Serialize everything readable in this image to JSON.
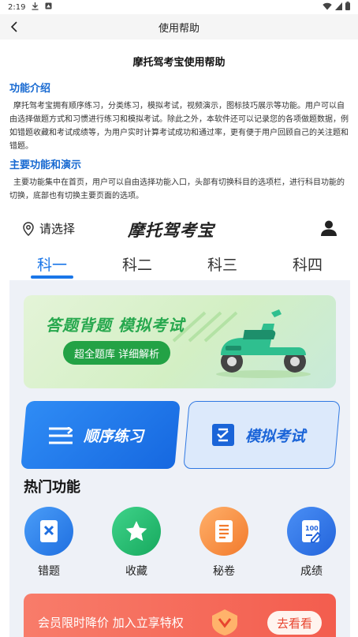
{
  "status_bar": {
    "time": "2:19"
  },
  "nav": {
    "title": "使用帮助"
  },
  "doc": {
    "title": "摩托驾考宝使用帮助",
    "sections": [
      {
        "heading": "功能介绍",
        "body": "摩托驾考宝拥有顺序练习，分类练习，模拟考试，视频演示，图标技巧展示等功能。用户可以自由选择做题方式和习惯进行练习和模拟考试。除此之外，本软件还可以记录您的各项做题数据，例如错题收藏和考试成绩等，为用户实时计算考试成功和通过率，更有便于用户回顾自己的关注题和错题。"
      },
      {
        "heading": "主要功能和演示",
        "body": "主要功能集中在首页，用户可以自由选择功能入口，头部有切换科目的选项栏，进行科目功能的切换，底部也有切换主要页面的选项。"
      }
    ]
  },
  "app": {
    "location_label": "请选择",
    "logo_text": "摩托驾考宝",
    "tabs": [
      "科一",
      "科二",
      "科三",
      "科四"
    ],
    "active_tab": 0,
    "banner": {
      "slogan": "答题背题  模拟考试",
      "pill": "超全题库 详细解析"
    },
    "cards": {
      "sequential": "顺序练习",
      "mock": "模拟考试"
    },
    "hot_title": "热门功能",
    "features": [
      {
        "label": "错题",
        "icon": "wrong-questions-icon"
      },
      {
        "label": "收藏",
        "icon": "star-icon"
      },
      {
        "label": "秘卷",
        "icon": "secret-paper-icon"
      },
      {
        "label": "成绩",
        "icon": "score-icon"
      }
    ],
    "vip": {
      "text": "会员限时降价 加入立享特权",
      "button": "去看看"
    }
  },
  "colors": {
    "accent": "#1a76e8",
    "heading_blue": "#1769d1",
    "banner_green": "#23a245",
    "vip_red": "#f35d4e"
  }
}
